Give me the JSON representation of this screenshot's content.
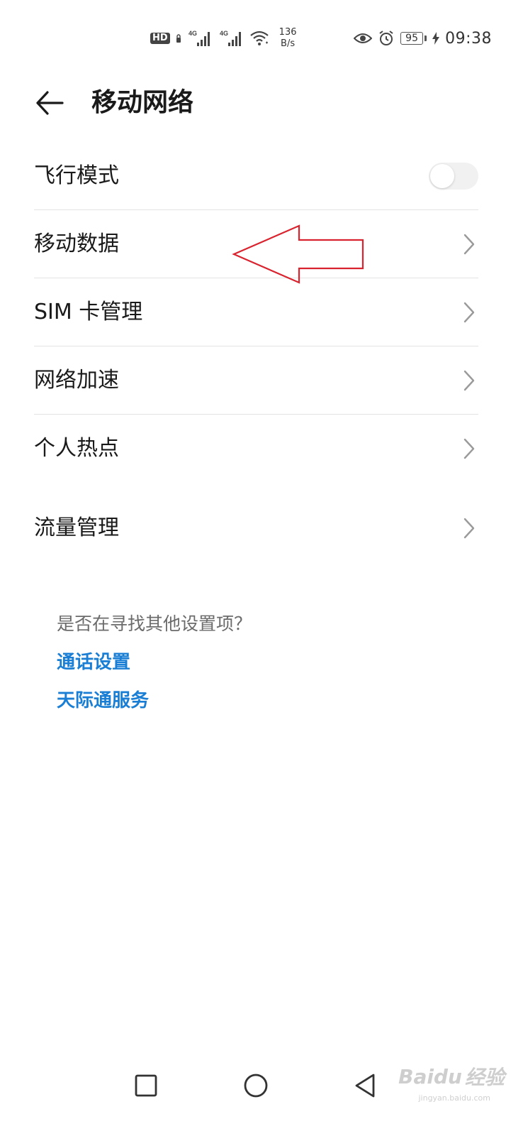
{
  "status_bar": {
    "hd_badge": "HD",
    "net_speed_value": "136",
    "net_speed_unit": "B/s",
    "battery_level": "95",
    "time": "09:38",
    "icons": [
      "hd-icon",
      "4g-signal-icon",
      "4g-signal-icon",
      "wifi-icon",
      "eye-icon",
      "alarm-icon",
      "battery-icon",
      "charging-icon"
    ]
  },
  "header": {
    "title": "移动网络",
    "back_icon": "arrow-left-icon"
  },
  "settings": {
    "items": [
      {
        "label": "飞行模式",
        "control": "toggle",
        "toggle_on": false
      },
      {
        "label": "移动数据",
        "control": "chevron"
      },
      {
        "label": "SIM 卡管理",
        "control": "chevron"
      },
      {
        "label": "网络加速",
        "control": "chevron"
      },
      {
        "label": "个人热点",
        "control": "chevron"
      },
      {
        "label": "流量管理",
        "control": "chevron"
      }
    ]
  },
  "suggestions": {
    "question": "是否在寻找其他设置项？",
    "links": [
      "通话设置",
      "天际通服务"
    ]
  },
  "nav_bar": {
    "icons": [
      "square-recent-icon",
      "circle-home-icon",
      "triangle-back-icon"
    ]
  },
  "watermark": {
    "brand": "Baidu",
    "suffix": "经验",
    "url": "jingyan.baidu.com"
  },
  "colors": {
    "link": "#1a7fd4",
    "annotation_arrow": "#d9232e",
    "divider": "#e3e3e3"
  }
}
